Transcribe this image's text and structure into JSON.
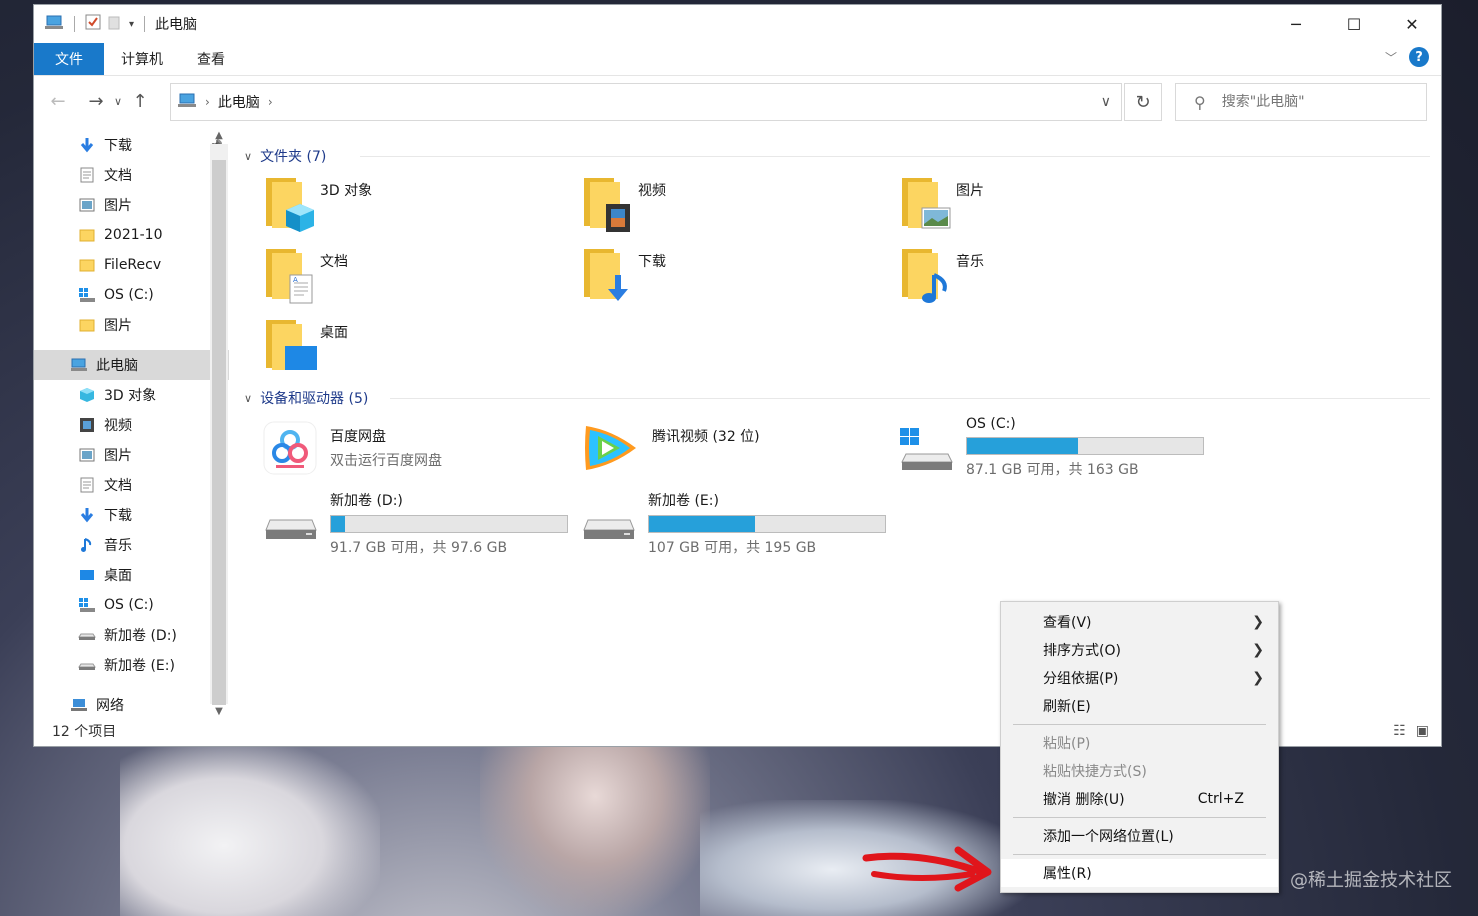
{
  "window": {
    "title": "此电脑",
    "controls": {
      "minimize": "─",
      "maximize": "☐",
      "close": "✕"
    }
  },
  "ribbon": {
    "tabs": [
      "文件",
      "计算机",
      "查看"
    ],
    "help": "?"
  },
  "address": {
    "crumb": "此电脑",
    "search_placeholder": "搜索\"此电脑\""
  },
  "sidebar": {
    "items": [
      {
        "label": "下载",
        "icon": "download-icon",
        "pinned": true
      },
      {
        "label": "文档",
        "icon": "document-icon",
        "pinned": true
      },
      {
        "label": "图片",
        "icon": "picture-icon",
        "pinned": true
      },
      {
        "label": "2021-10",
        "icon": "folder-icon"
      },
      {
        "label": "FileRecv",
        "icon": "folder-icon"
      },
      {
        "label": "OS (C:)",
        "icon": "windows-drive-icon"
      },
      {
        "label": "图片",
        "icon": "folder-icon"
      },
      {
        "label": "此电脑",
        "icon": "this-pc-icon",
        "selected": true
      },
      {
        "label": "3D 对象",
        "icon": "3d-objects-icon"
      },
      {
        "label": "视频",
        "icon": "video-icon"
      },
      {
        "label": "图片",
        "icon": "picture-icon"
      },
      {
        "label": "文档",
        "icon": "document-icon"
      },
      {
        "label": "下载",
        "icon": "download-icon"
      },
      {
        "label": "音乐",
        "icon": "music-icon"
      },
      {
        "label": "桌面",
        "icon": "desktop-icon"
      },
      {
        "label": "OS (C:)",
        "icon": "windows-drive-icon"
      },
      {
        "label": "新加卷 (D:)",
        "icon": "drive-icon"
      },
      {
        "label": "新加卷 (E:)",
        "icon": "drive-icon"
      },
      {
        "label": "网络",
        "icon": "network-icon"
      }
    ]
  },
  "status": {
    "item_count": "12 个项目"
  },
  "folders_group": {
    "header": "文件夹 (7)",
    "items": [
      {
        "label": "3D 对象",
        "icon": "3d-objects-icon"
      },
      {
        "label": "视频",
        "icon": "video-icon"
      },
      {
        "label": "图片",
        "icon": "picture-icon"
      },
      {
        "label": "文档",
        "icon": "document-icon"
      },
      {
        "label": "下载",
        "icon": "download-icon"
      },
      {
        "label": "音乐",
        "icon": "music-icon"
      },
      {
        "label": "桌面",
        "icon": "desktop-icon"
      }
    ]
  },
  "devices_group": {
    "header": "设备和驱动器 (5)",
    "items": [
      {
        "label": "百度网盘",
        "sub": "双击运行百度网盘",
        "icon": "baidu-netdisk-icon"
      },
      {
        "label": "腾讯视频 (32 位)",
        "icon": "tencent-video-icon"
      },
      {
        "label": "OS (C:)",
        "sub": "87.1 GB 可用，共 163 GB",
        "used_fraction": 0.47,
        "icon": "windows-drive-icon"
      },
      {
        "label": "新加卷 (D:)",
        "sub": "91.7 GB 可用，共 97.6 GB",
        "used_fraction": 0.06,
        "icon": "drive-icon"
      },
      {
        "label": "新加卷 (E:)",
        "sub": "107 GB 可用，共 195 GB",
        "used_fraction": 0.45,
        "icon": "drive-icon"
      }
    ]
  },
  "context_menu": {
    "view": "查看(V)",
    "sort": "排序方式(O)",
    "group": "分组依据(P)",
    "refresh": "刷新(E)",
    "paste": "粘贴(P)",
    "paste_shortcut": "粘贴快捷方式(S)",
    "undo": "撤消 删除(U)",
    "undo_shortcut": "Ctrl+Z",
    "add_network": "添加一个网络位置(L)",
    "properties": "属性(R)"
  },
  "watermark": "@稀土掘金技术社区",
  "colors": {
    "accent": "#1979ca",
    "bar_fill": "#26a0da",
    "folder": "#fcd561",
    "annotation_arrow": "#e0151b"
  }
}
